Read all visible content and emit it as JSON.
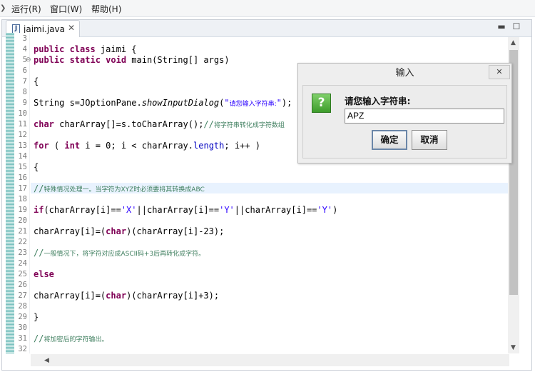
{
  "menubar": {
    "items": [
      "运行(R)",
      "窗口(W)",
      "帮助(H)"
    ]
  },
  "editor": {
    "tab_label": "jaimi.java",
    "tab_icon": "java-file-icon",
    "lines": [
      {
        "n": "3",
        "html": ""
      },
      {
        "n": "4",
        "html": "<span class='kw'>public class</span> jaimi {"
      },
      {
        "n": "5",
        "html": "<span class='kw'>public static void</span> main(String[] args)",
        "fold": true
      },
      {
        "n": "6",
        "html": ""
      },
      {
        "n": "7",
        "html": "{"
      },
      {
        "n": "8",
        "html": ""
      },
      {
        "n": "9",
        "html": "String s=JOptionPane.<span class='it'>showInputDialog</span>(<span class='str'>\"<span class='small-cn'>请您输入字符串:</span>\"</span>);"
      },
      {
        "n": "10",
        "html": ""
      },
      {
        "n": "11",
        "html": "<span class='kw'>char</span> charArray[]=s.toCharArray();<span class='cmt'>//<span class='small-cn'>将字符串转化成字符数组</span></span>"
      },
      {
        "n": "12",
        "html": ""
      },
      {
        "n": "13",
        "html": "<span class='kw'>for</span> ( <span class='kw'>int</span> i = 0; i &lt; charArray.<span class='var'>length</span>; i++ )"
      },
      {
        "n": "14",
        "html": ""
      },
      {
        "n": "15",
        "html": "{"
      },
      {
        "n": "16",
        "html": ""
      },
      {
        "n": "17",
        "html": "<span class='cmt'>//<span class='small-cn'>特殊情况处理一。当字符为XYZ时必须要将其转换成ABC</span></span>"
      },
      {
        "n": "18",
        "html": ""
      },
      {
        "n": "19",
        "html": "<span class='kw'>if</span>(charArray[i]==<span class='str'>'X'</span>||charArray[i]==<span class='str'>'Y'</span>||charArray[i]==<span class='str'>'Y'</span>)"
      },
      {
        "n": "20",
        "html": ""
      },
      {
        "n": "21",
        "html": "charArray[i]=(<span class='kw'>char</span>)(charArray[i]-23);"
      },
      {
        "n": "22",
        "html": ""
      },
      {
        "n": "23",
        "html": "<span class='cmt'>//<span class='small-cn'>一般情况下，将字符对应成ASCII码+3后再转化成字符。</span></span>"
      },
      {
        "n": "24",
        "html": ""
      },
      {
        "n": "25",
        "html": "<span class='kw'>else</span>"
      },
      {
        "n": "26",
        "html": ""
      },
      {
        "n": "27",
        "html": "charArray[i]=(<span class='kw'>char</span>)(charArray[i]+3);"
      },
      {
        "n": "28",
        "html": ""
      },
      {
        "n": "29",
        "html": "}"
      },
      {
        "n": "30",
        "html": ""
      },
      {
        "n": "31",
        "html": "<span class='cmt'>//<span class='small-cn'>将加密后的字符输出。</span></span>"
      },
      {
        "n": "32",
        "html": ""
      }
    ]
  },
  "dialog": {
    "title": "输入",
    "prompt": "请您输入字符串:",
    "input_value": "APZ",
    "ok_label": "确定",
    "cancel_label": "取消",
    "icon": "question-icon"
  },
  "colors": {
    "keyword": "#7f0055",
    "string": "#2a00ff",
    "comment": "#3f7f5f"
  }
}
